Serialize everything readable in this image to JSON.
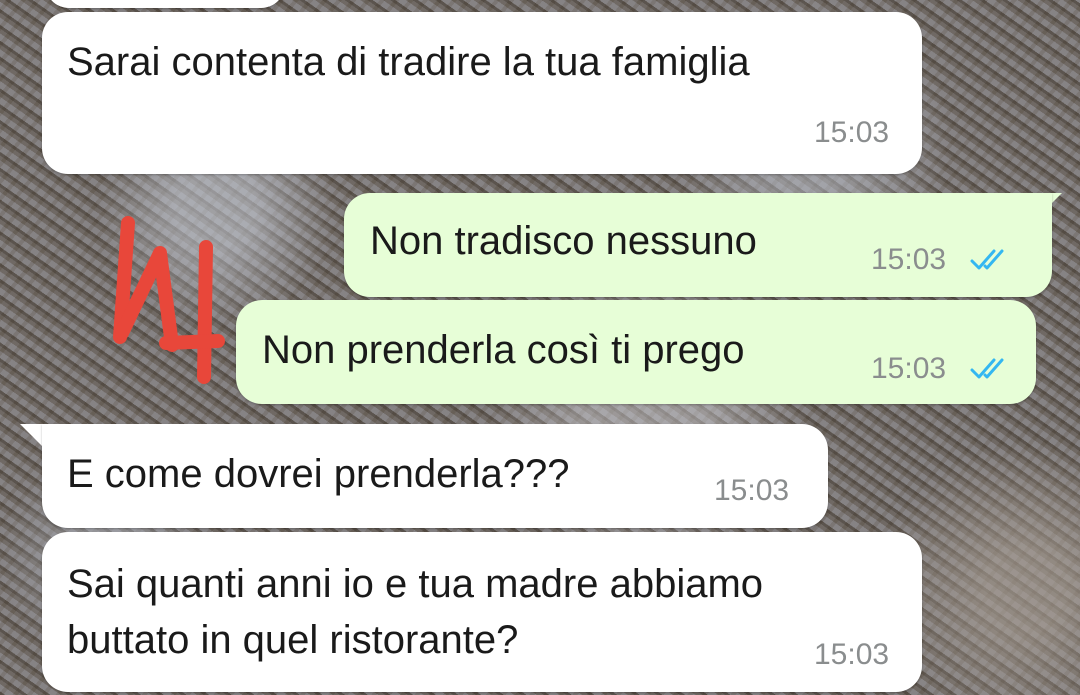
{
  "messages": [
    {
      "id": "m0",
      "direction": "incoming",
      "text": "",
      "time": ""
    },
    {
      "id": "m1",
      "direction": "incoming",
      "text": "Sarai contenta di tradire la tua famiglia",
      "time": "15:03"
    },
    {
      "id": "m2",
      "direction": "outgoing",
      "text": "Non tradisco nessuno",
      "time": "15:03",
      "status": "read"
    },
    {
      "id": "m3",
      "direction": "outgoing",
      "text": "Non prenderla così ti prego",
      "time": "15:03",
      "status": "read"
    },
    {
      "id": "m4",
      "direction": "incoming",
      "text": "E come dovrei prenderla???",
      "time": "15:03"
    },
    {
      "id": "m5",
      "direction": "incoming",
      "lines": [
        "Sai quanti anni io e tua madre abbiamo",
        "buttato in quel ristorante?"
      ],
      "time": "15:03"
    }
  ],
  "icons": {
    "read_receipt": "double-check-icon",
    "annotation": "red-scribble-annotation"
  },
  "colors": {
    "incoming_bubble": "#ffffff",
    "outgoing_bubble": "#e7fed7",
    "read_check": "#34b7f1",
    "timestamp": "#8a8d8e",
    "annotation": "#e8473a"
  }
}
